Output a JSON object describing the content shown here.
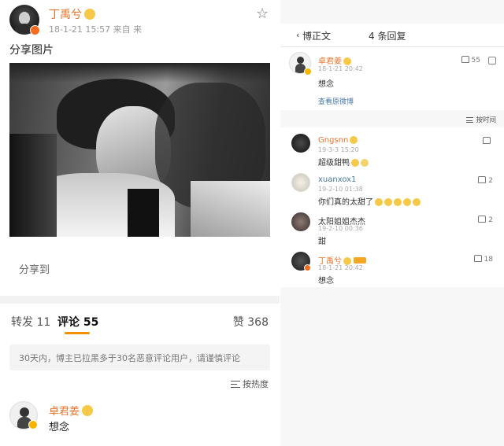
{
  "left": {
    "post": {
      "author": "丁禹兮",
      "time": "18-1-21 15:57",
      "source": "来自 来",
      "text": "分享图片"
    },
    "share_label": "分享到",
    "tabs": [
      {
        "label": "转发",
        "count": "11"
      },
      {
        "label": "评论",
        "count": "55"
      }
    ],
    "likes": {
      "label": "赞",
      "count": "368"
    },
    "notice": "30天内，博主已拉黑多于30名恶意评论用户，请谨慎评论",
    "sort_label": "按热度",
    "comment": {
      "name": "卓君姜",
      "text": "想念"
    }
  },
  "right": {
    "header": {
      "back": "‹",
      "title": "博正文",
      "count": "4 条回复"
    },
    "main": {
      "name": "卓君姜",
      "time": "18-1-21 20:42",
      "text": "想念",
      "likes": "55",
      "link": "查看原微博"
    },
    "sort_label": "按时间",
    "replies": [
      {
        "name": "Gngsnn",
        "time": "19-3-3 15:20",
        "text": "超级甜鸭",
        "likes": ""
      },
      {
        "name": "xuanxox1",
        "time": "19-2-10 01:38",
        "text": "你们真的太甜了",
        "likes": "2"
      },
      {
        "name": "太阳姐姐杰杰",
        "time": "19-2-10 00:36",
        "text": "甜",
        "likes": "2"
      },
      {
        "name": "丁禹兮",
        "time": "18-1-21 20:42",
        "text": "想念",
        "likes": "18"
      }
    ]
  },
  "colors": {
    "username": "#e8742c",
    "tab_accent": "#f29100",
    "link": "#4a78a6"
  }
}
